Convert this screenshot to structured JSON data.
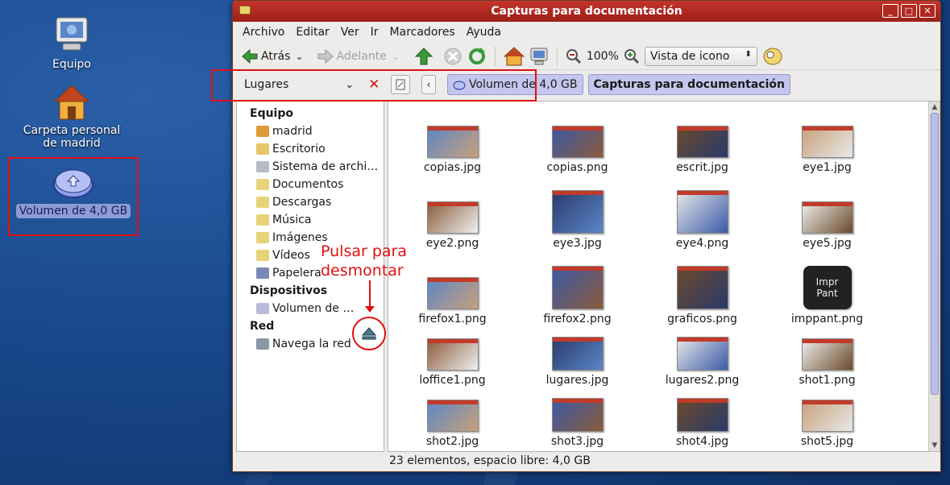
{
  "desktop": {
    "icons": [
      {
        "label": "Equipo"
      },
      {
        "label": "Carpeta personal\nde madrid"
      },
      {
        "label": "Volumen de 4,0 GB"
      }
    ]
  },
  "window": {
    "title": "Capturas para documentación",
    "menu": [
      "Archivo",
      "Editar",
      "Ver",
      "Ir",
      "Marcadores",
      "Ayuda"
    ],
    "toolbar": {
      "back_label": "Atrás",
      "forward_label": "Adelante",
      "zoom_level": "100%",
      "view_mode": "Vista de icono"
    },
    "places": {
      "header_label": "Lugares",
      "sections": [
        {
          "title": "Equipo",
          "items": [
            "madrid",
            "Escritorio",
            "Sistema de archi…",
            "Documentos",
            "Descargas",
            "Música",
            "Imágenes",
            "Vídeos",
            "Papelera"
          ]
        },
        {
          "title": "Dispositivos",
          "items": [
            "Volumen de …"
          ]
        },
        {
          "title": "Red",
          "items": [
            "Navega la red"
          ]
        }
      ]
    },
    "path": {
      "parent": "Volumen de 4,0 GB",
      "current": "Capturas para documentación"
    },
    "files": [
      "copias.jpg",
      "copias.png",
      "escrit.jpg",
      "eye1.jpg",
      "eye2.png",
      "eye3.jpg",
      "eye4.png",
      "eye5.jpg",
      "firefox1.png",
      "firefox2.png",
      "graficos.png",
      "imppant.png",
      "loffice1.png",
      "lugares.jpg",
      "lugares2.png",
      "shot1.png",
      "shot2.jpg",
      "shot3.jpg",
      "shot4.jpg",
      "shot5.jpg"
    ],
    "imppant_key": "Impr\nPant",
    "status": "23 elementos, espacio libre: 4,0 GB"
  },
  "annotation": {
    "text": "Pulsar para\ndesmontar"
  }
}
